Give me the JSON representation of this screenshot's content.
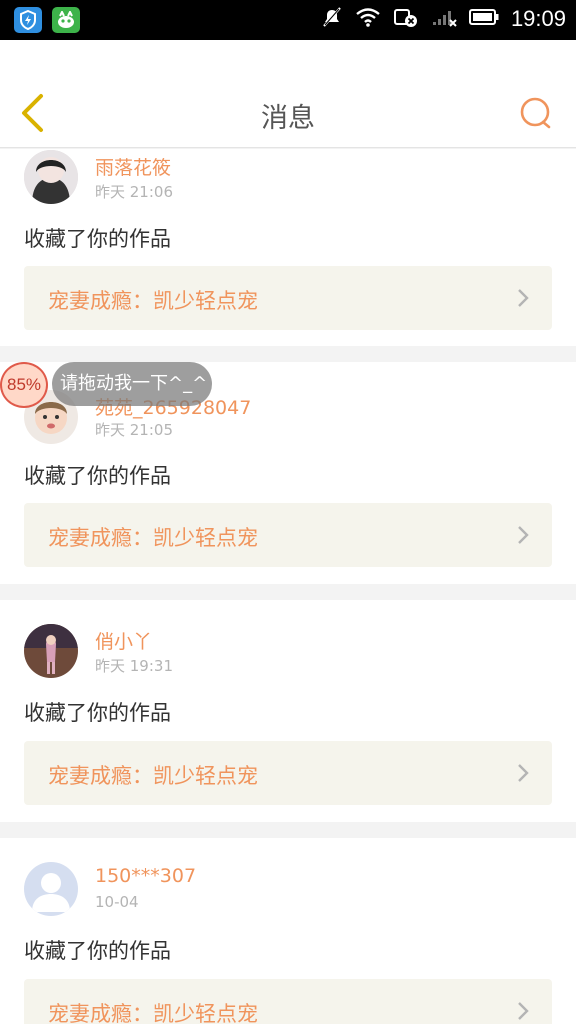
{
  "status_bar": {
    "time": "19:09"
  },
  "header": {
    "title": "消息"
  },
  "messages": [
    {
      "user": "雨落花筱",
      "time": "昨天 21:06",
      "action": "收藏了你的作品",
      "work": "宠妻成瘾：凯少轻点宠"
    },
    {
      "user": "苑苑_265928047",
      "time": "昨天 21:05",
      "action": "收藏了你的作品",
      "work": "宠妻成瘾：凯少轻点宠"
    },
    {
      "user": "俏小丫",
      "time": "昨天 19:31",
      "action": "收藏了你的作品",
      "work": "宠妻成瘾：凯少轻点宠"
    },
    {
      "user": "150***307",
      "time": "10-04",
      "action": "收藏了你的作品",
      "work": "宠妻成瘾：凯少轻点宠"
    }
  ],
  "float_widget": {
    "percent": "85%",
    "tip": "请拖动我一下^_^"
  },
  "colors": {
    "accent": "#f0945c",
    "back_arrow": "#d9b200",
    "work_bg": "#f5f4ec"
  }
}
